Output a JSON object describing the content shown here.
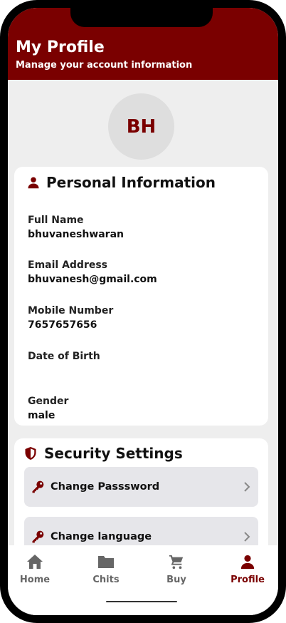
{
  "header": {
    "title": "My Profile",
    "subtitle": "Manage your account information"
  },
  "avatar": {
    "initials": "BH"
  },
  "personal": {
    "title": "Personal Information",
    "fields": [
      {
        "label": "Full Name",
        "value": "bhuvaneshwaran"
      },
      {
        "label": "Email Address",
        "value": "bhuvanesh@gmail.com"
      },
      {
        "label": "Mobile Number",
        "value": "7657657656"
      },
      {
        "label": "Date of Birth",
        "value": ""
      },
      {
        "label": "Gender",
        "value": "male"
      }
    ]
  },
  "security": {
    "title": "Security Settings",
    "items": [
      {
        "label": "Change Passsword",
        "icon": "key-icon"
      },
      {
        "label": "Change language",
        "icon": "key-icon"
      }
    ]
  },
  "nav": {
    "items": [
      {
        "label": "Home",
        "icon": "home-icon",
        "active": false
      },
      {
        "label": "Chits",
        "icon": "folder-icon",
        "active": false
      },
      {
        "label": "Buy",
        "icon": "cart-icon",
        "active": false
      },
      {
        "label": "Profile",
        "icon": "person-icon",
        "active": true
      }
    ]
  },
  "colors": {
    "brand": "#7a0000",
    "background": "#eeeeee",
    "row": "#e6e6ea",
    "inactive": "#666666"
  }
}
